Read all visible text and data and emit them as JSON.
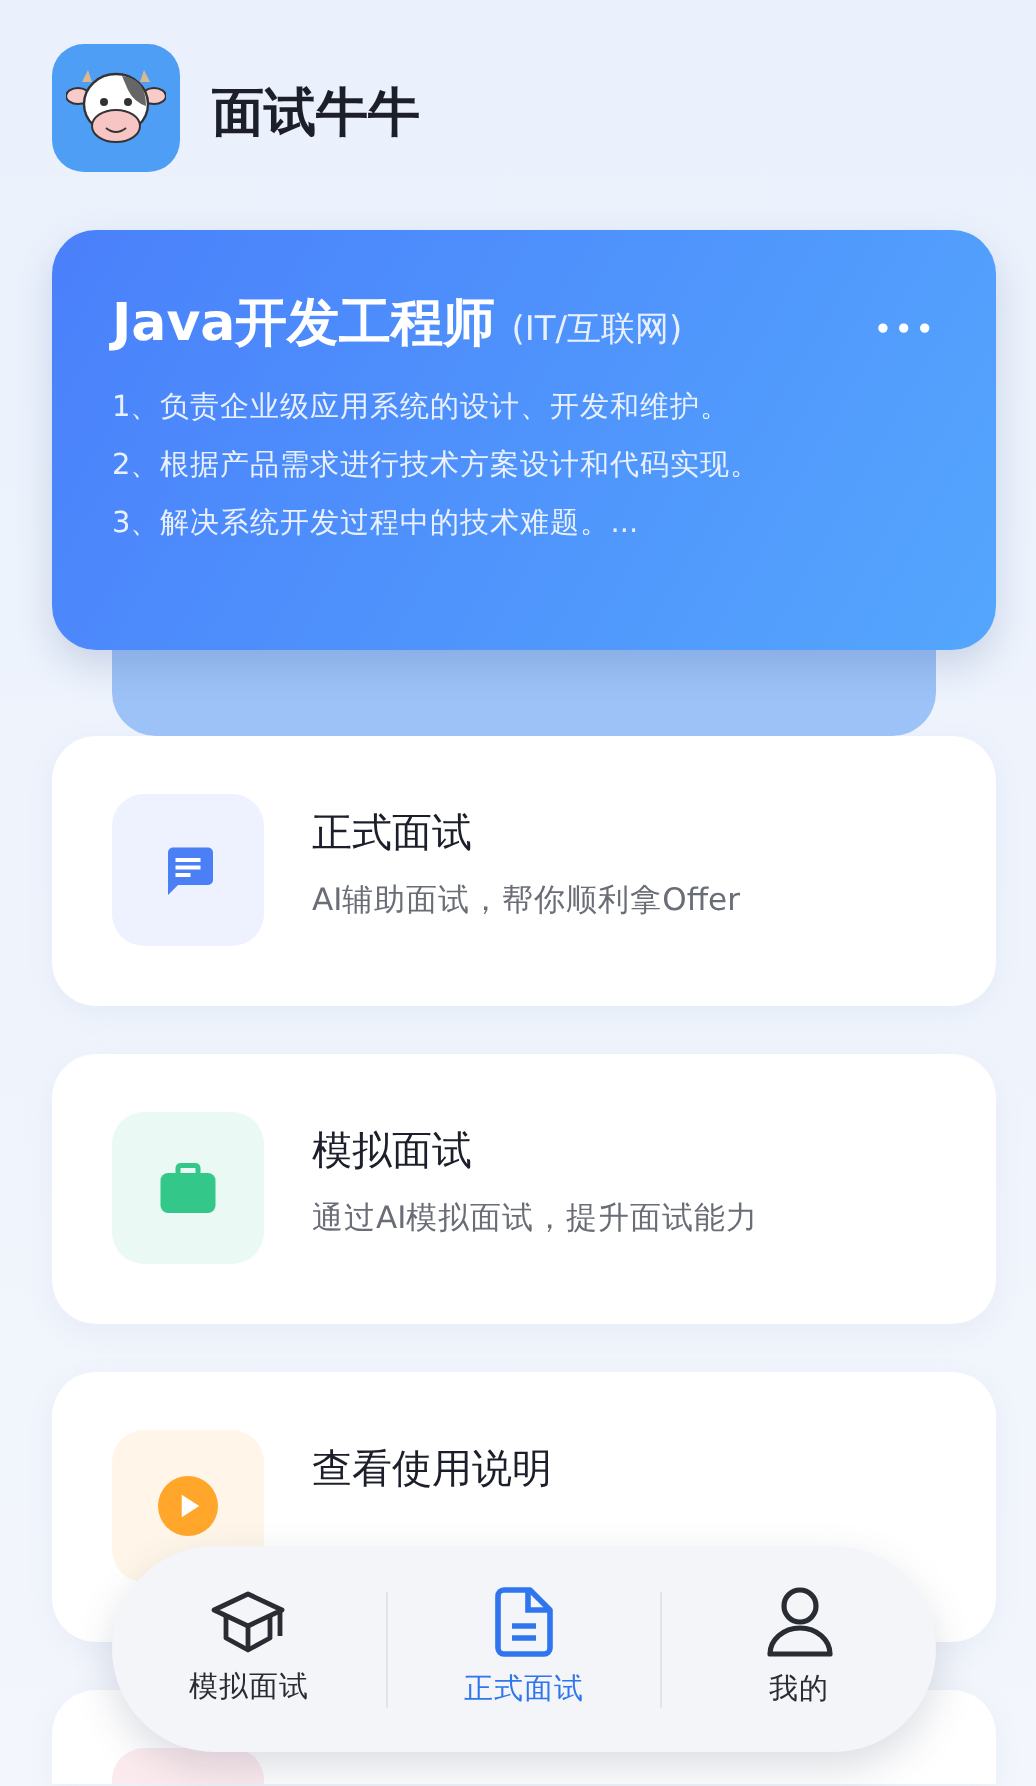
{
  "app": {
    "title": "面试牛牛"
  },
  "job_card": {
    "title": "Java开发工程师",
    "category": "(IT/互联网)",
    "menu": "•••",
    "duties": [
      "1、负责企业级应用系统的设计、开发和维护。",
      "2、根据产品需求进行技术方案设计和代码实现。",
      "3、解决系统开发过程中的技术难题。..."
    ]
  },
  "features": [
    {
      "kind": "chat",
      "color": "#4a7ff5",
      "title": "正式面试",
      "subtitle": "AI辅助面试，帮你顺利拿Offer"
    },
    {
      "kind": "briefcase",
      "color": "#34c78a",
      "title": "模拟面试",
      "subtitle": "通过AI模拟面试，提升面试能力"
    },
    {
      "kind": "play",
      "color": "#ffa62b",
      "title": "查看使用说明"
    },
    {
      "kind": "cut",
      "color": "#fcebee"
    }
  ],
  "nav": [
    {
      "kind": "cap",
      "label": "模拟面试",
      "selected": false
    },
    {
      "kind": "doc",
      "label": "正式面试",
      "selected": true
    },
    {
      "kind": "user",
      "label": "我的",
      "selected": false
    }
  ]
}
